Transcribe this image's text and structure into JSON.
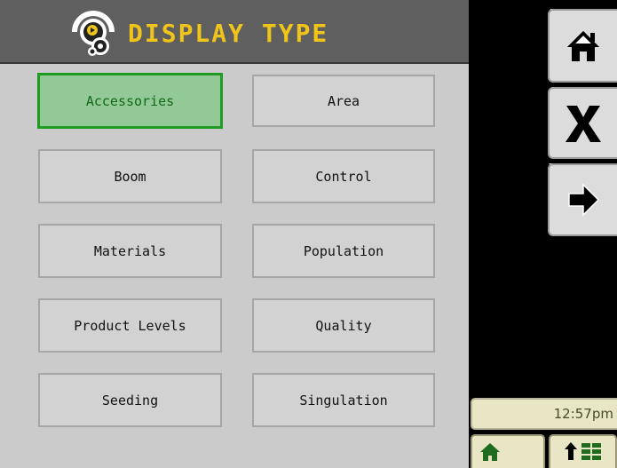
{
  "header": {
    "title": "DISPLAY TYPE",
    "icon": "display-type-gear-icon"
  },
  "grid": {
    "buttons": [
      {
        "label": "Accessories",
        "selected": true
      },
      {
        "label": "Area",
        "selected": false
      },
      {
        "label": "Boom",
        "selected": false
      },
      {
        "label": "Control",
        "selected": false
      },
      {
        "label": "Materials",
        "selected": false
      },
      {
        "label": "Population",
        "selected": false
      },
      {
        "label": "Product Levels",
        "selected": false
      },
      {
        "label": "Quality",
        "selected": false
      },
      {
        "label": "Seeding",
        "selected": false
      },
      {
        "label": "Singulation",
        "selected": false
      }
    ]
  },
  "softkeys": [
    {
      "key": "F",
      "icon": "home-icon"
    },
    {
      "key": "G",
      "icon": "close-icon"
    },
    {
      "key": "H",
      "icon": "arrow-right-icon"
    }
  ],
  "status": {
    "time": "12:57pm"
  },
  "bottom_tabs": [
    {
      "icon": "home-icon"
    },
    {
      "icon": "up-arrow-layout-icon"
    }
  ],
  "colors": {
    "title_text": "#f0c418",
    "selected_fill": "#93c996",
    "selected_border": "#1f9a22"
  }
}
